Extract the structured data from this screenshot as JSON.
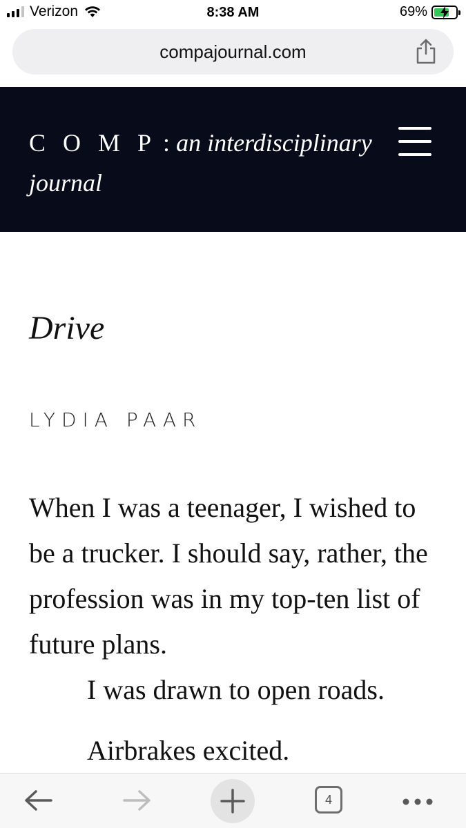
{
  "status_bar": {
    "carrier": "Verizon",
    "time": "8:38 AM",
    "battery_percent": "69%",
    "battery_level": 0.69,
    "icons": [
      "signal-icon",
      "wifi-icon",
      "battery-charging-icon"
    ]
  },
  "browser": {
    "url": "compajournal.com",
    "tab_count": "4",
    "icons": [
      "share-icon",
      "back-arrow-icon",
      "forward-arrow-icon",
      "plus-icon",
      "tabs-icon",
      "more-dots-icon"
    ]
  },
  "site": {
    "title_brand": "C O M P",
    "title_sep": " : ",
    "title_sub": "an interdisciplinary journal",
    "background_color": "#070b1a"
  },
  "article": {
    "title": "Drive",
    "author": "LYDIA PAAR",
    "paragraph_1": "When I was a teenager, I wished to be a trucker. I should say, rather, the profession was in my top-ten list of future plans.",
    "line_2": "I was drawn to open roads.",
    "line_3": "Airbrakes excited."
  },
  "colors": {
    "battery_fill": "#34c759",
    "url_bar": "#efeff1"
  }
}
